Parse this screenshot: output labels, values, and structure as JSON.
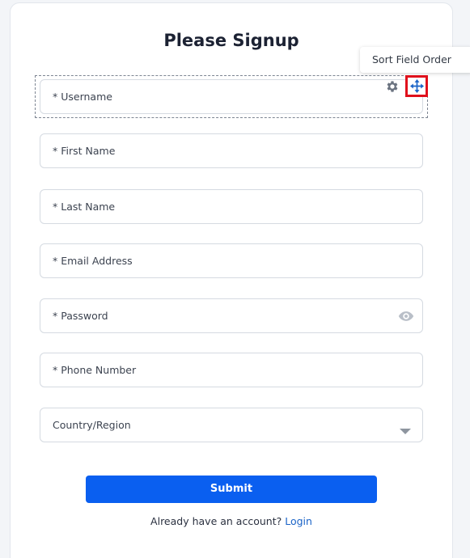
{
  "form": {
    "title": "Please Signup",
    "tooltip": "Sort Field Order",
    "fields": {
      "username": "* Username",
      "first_name": "* First Name",
      "last_name": "* Last Name",
      "email": "* Email Address",
      "password": "* Password",
      "phone": "* Phone Number",
      "country": "Country/Region"
    },
    "submit_label": "Submit",
    "login_prompt": "Already have an account?",
    "login_link": "Login"
  },
  "colors": {
    "accent": "#0a5ff0",
    "link": "#1a63c7",
    "highlight": "#e0101c",
    "icon_gray": "#6b7380"
  },
  "icons": [
    "gear-icon",
    "move-icon",
    "eye-icon",
    "chevron-down-icon"
  ]
}
